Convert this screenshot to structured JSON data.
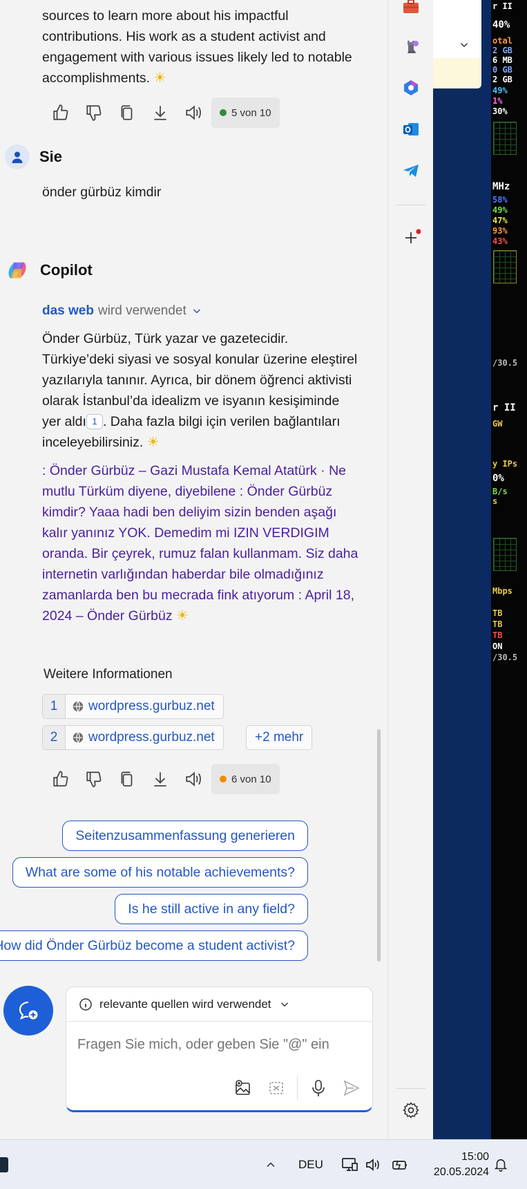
{
  "messages": {
    "prev_answer": {
      "text": "sources to learn more about his impactful contributions. His work as a student activist and engagement with various issues likely led to notable accomplishments.",
      "counter": "5 von 10",
      "counter_color": "#2e8b3a"
    },
    "user": {
      "name": "Sie",
      "text": "önder gürbüz kimdir"
    },
    "copilot": {
      "name": "Copilot",
      "web_source": "das web",
      "web_suffix": "wird verwendet",
      "para1_a": "Önder Gürbüz, Türk yazar ve gazetecidir. Türkiye’deki siyasi ve sosyal konular üzerine eleştirel yazılarıyla tanınır. Ayrıca, bir dönem öğrenci aktivisti olarak İstanbul’da idealizm ve isyanın kesişiminde yer aldı",
      "cite1": "1",
      "para1_b": ". Daha fazla bilgi için verilen bağlantıları inceleyebilirsiniz.",
      "para2": ": Önder Gürbüz – Gazi Mustafa Kemal Atatürk · Ne mutlu Türküm diyene, diyebilene : Önder Gürbüz kimdir? Yaaa hadi ben deliyim sizin benden aşağı kalır yanınız YOK. Demedim mi IZIN VERDIGIM oranda. Bir çeyrek, rumuz falan kullanmam. Siz daha internetin varlığından haberdar bile olmadığınız zamanlarda ben bu mecrada fink atıyorum : April 18, 2024 – Önder Gürbüz",
      "more_title": "Weitere Informationen",
      "sources": [
        {
          "num": "1",
          "host": "wordpress.gurbuz.net"
        },
        {
          "num": "2",
          "host": "wordpress.gurbuz.net"
        }
      ],
      "more_label": "+2 mehr",
      "counter": "6 von 10",
      "counter_color": "#f08c00"
    }
  },
  "suggestions": [
    "Seitenzusammenfassung generieren",
    "What are some of his notable achievements?",
    "Is he still active in any field?",
    "How did Önder Gürbüz become a student activist?"
  ],
  "composer": {
    "mode_label": "relevante quellen wird verwendet",
    "placeholder": "Fragen Sie mich, oder geben Sie \"@\" ein"
  },
  "rail_icons": [
    "toolbox-icon",
    "chess-icon",
    "m365-icon",
    "outlook-icon",
    "telegram-icon",
    "add-icon",
    "settings-icon"
  ],
  "monitor": {
    "lines": [
      {
        "t": "r II",
        "c": "#ffffff"
      },
      {
        "t": "40%",
        "c": "#ffffff"
      },
      {
        "t": "otal",
        "c": "#ff9a3c"
      },
      {
        "t": "2 GB",
        "c": "#7fa6ff"
      },
      {
        "t": "6 MB",
        "c": "#ffffff"
      },
      {
        "t": "0 GB",
        "c": "#7fa6ff"
      },
      {
        "t": "2 GB",
        "c": "#ffffff"
      },
      {
        "t": "49%",
        "c": "#4cc3ff"
      },
      {
        "t": "1%",
        "c": "#ff6af0"
      },
      {
        "t": "30%",
        "c": "#ffffff"
      }
    ],
    "lines2": [
      {
        "t": "MHz",
        "c": "#ffffff"
      },
      {
        "t": "58%",
        "c": "#4c7dff"
      },
      {
        "t": "49%",
        "c": "#7bdc4a"
      },
      {
        "t": "47%",
        "c": "#e6e64c"
      },
      {
        "t": "93%",
        "c": "#ff9a3c"
      },
      {
        "t": "43%",
        "c": "#ff4c4c"
      }
    ],
    "version": "/30.5",
    "lines3": [
      {
        "t": "r II",
        "c": "#ffffff"
      },
      {
        "t": "GW",
        "c": "#e6c84c"
      },
      {
        "t": "y IPs",
        "c": "#e6c84c"
      },
      {
        "t": "0%",
        "c": "#ffffff"
      },
      {
        "t": "B/s",
        "c": "#7bdc4a"
      },
      {
        "t": "s",
        "c": "#e6c84c"
      }
    ],
    "lines4": [
      {
        "t": "Mbps",
        "c": "#e6c84c"
      },
      {
        "t": "TB",
        "c": "#e6c84c"
      },
      {
        "t": "TB",
        "c": "#e6c84c"
      },
      {
        "t": "TB",
        "c": "#ff4c4c"
      },
      {
        "t": "ON",
        "c": "#ffffff"
      },
      {
        "t": "/30.5",
        "c": "#bbbbbb"
      }
    ]
  },
  "taskbar": {
    "language": "DEU",
    "time": "15:00",
    "date": "20.05.2024"
  }
}
